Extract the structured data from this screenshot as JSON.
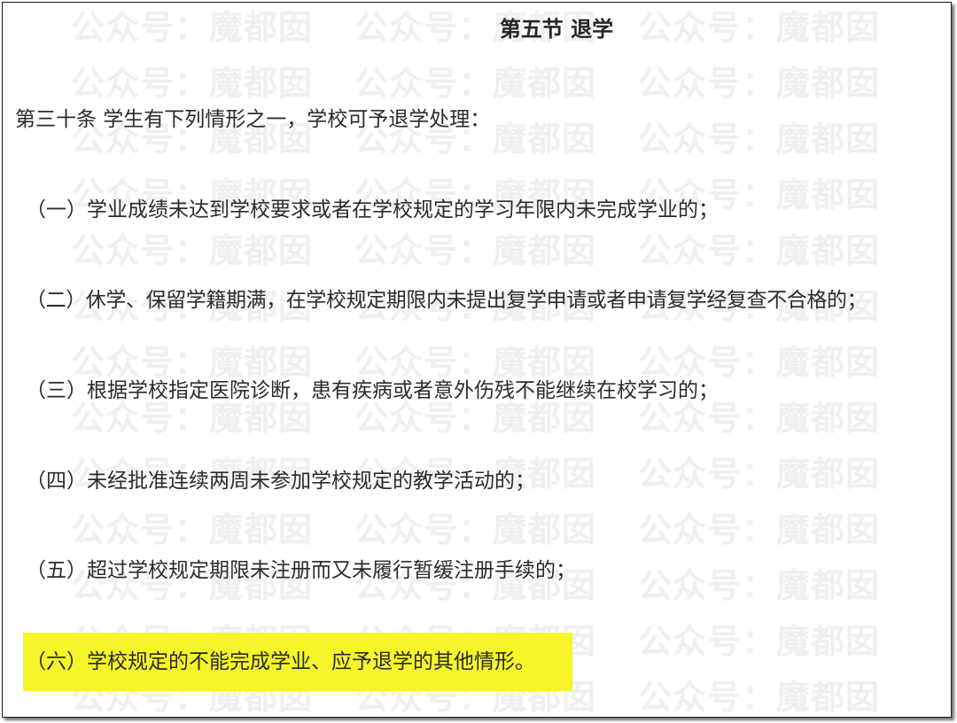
{
  "document": {
    "title": "第五节 退学",
    "intro": "第三十条 学生有下列情形之一，学校可予退学处理：",
    "items": [
      "（一）学业成绩未达到学校要求或者在学校规定的学习年限内未完成学业的；",
      "（二）休学、保留学籍期满，在学校规定期限内未提出复学申请或者申请复学经复查不合格的；",
      "（三）根据学校指定医院诊断，患有疾病或者意外伤残不能继续在校学习的；",
      "（四）未经批准连续两周未参加学校规定的教学活动的；",
      "（五）超过学校规定期限未注册而又未履行暂缓注册手续的；",
      "（六）学校规定的不能完成学业、应予退学的其他情形。"
    ],
    "highlight_color": "#f5f52a"
  },
  "watermark": {
    "text": "公众号：魔都囡"
  }
}
